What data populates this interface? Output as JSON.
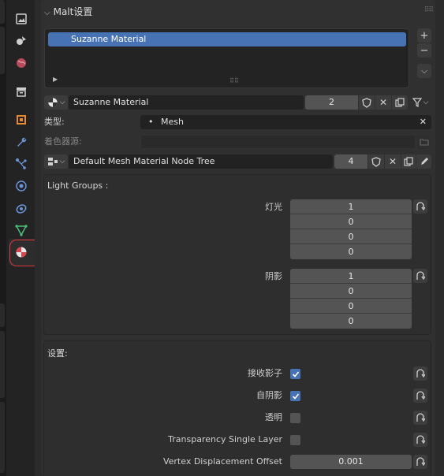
{
  "panel": {
    "title": "Malt设置"
  },
  "material_list": {
    "items": [
      {
        "name": "Suzanne Material",
        "selected": true
      }
    ]
  },
  "material_slot": {
    "name": "Suzanne Material",
    "users": "2"
  },
  "type_row": {
    "label": "类型:",
    "value": "Mesh"
  },
  "shader_source": {
    "label": "着色器源:"
  },
  "node_tree": {
    "name": "Default Mesh Material Node Tree",
    "users": "4"
  },
  "light_groups": {
    "title": "Light Groups :",
    "light": {
      "label": "灯光",
      "values": [
        "1",
        "0",
        "0",
        "0"
      ]
    },
    "shadow": {
      "label": "阴影",
      "values": [
        "1",
        "0",
        "0",
        "0"
      ]
    }
  },
  "settings": {
    "title": "设置:",
    "receive_shadow": {
      "label": "接收影子",
      "checked": true
    },
    "self_shadow": {
      "label": "自阴影",
      "checked": true
    },
    "transparent": {
      "label": "透明",
      "checked": false
    },
    "transparency_single_layer": {
      "label": "Transparency Single Layer",
      "checked": false
    },
    "vertex_displacement_offset": {
      "label": "Vertex Displacement Offset",
      "value": "0.001"
    }
  },
  "colors": {
    "accent": "#4772b3",
    "highlight": "#e0363c"
  }
}
